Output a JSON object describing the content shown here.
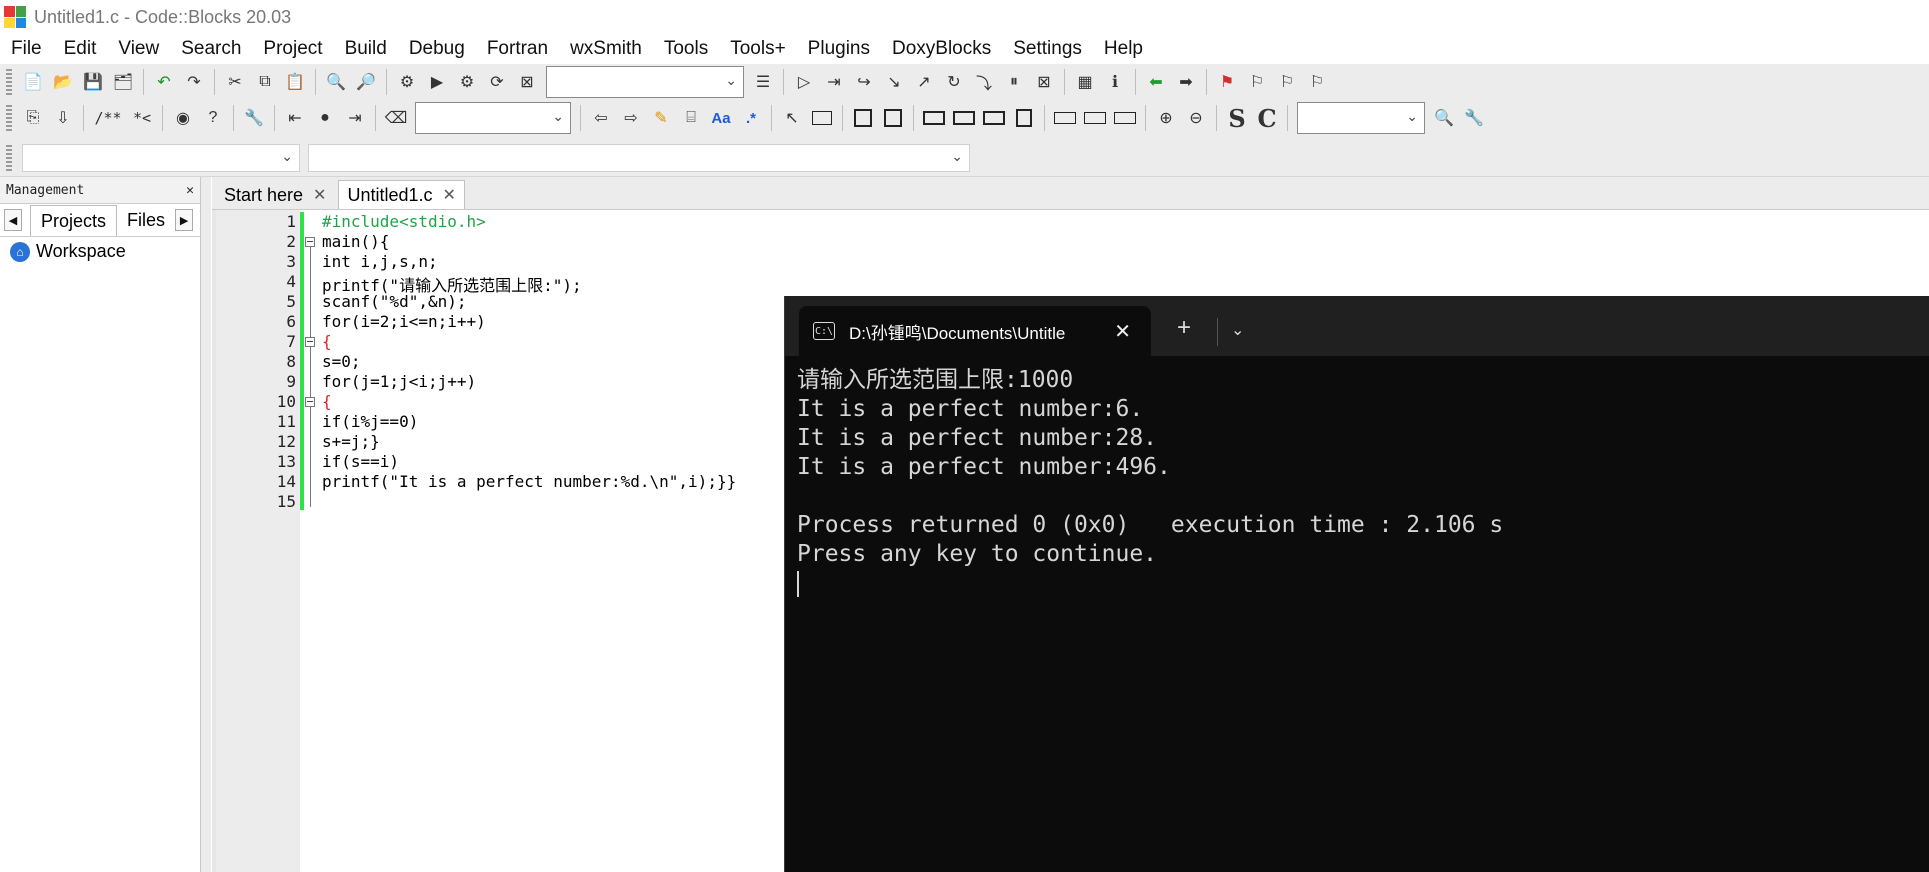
{
  "window": {
    "title": "Untitled1.c - Code::Blocks 20.03"
  },
  "menu": [
    "File",
    "Edit",
    "View",
    "Search",
    "Project",
    "Build",
    "Debug",
    "Fortran",
    "wxSmith",
    "Tools",
    "Tools+",
    "Plugins",
    "DoxyBlocks",
    "Settings",
    "Help"
  ],
  "toolbar": {
    "doxy_comment": "/**",
    "doxy_inline": "*<",
    "regex_label": "Aa",
    "regex_dot": ".*",
    "bold_s": "S",
    "bold_c": "C"
  },
  "management": {
    "title": "Management",
    "tabs": [
      "Projects",
      "Files"
    ],
    "workspace": "Workspace"
  },
  "editor": {
    "tabs": [
      "Start here",
      "Untitled1.c"
    ],
    "active_tab": "Untitled1.c",
    "line_numbers": [
      "1",
      "2",
      "3",
      "4",
      "5",
      "6",
      "7",
      "8",
      "9",
      "10",
      "11",
      "12",
      "13",
      "14",
      "15"
    ],
    "lines": [
      "#include<stdio.h>",
      "main(){",
      "int i,j,s,n;",
      "printf(\"请输入所选范围上限:\");",
      "scanf(\"%d\",&n);",
      "for(i=2;i<=n;i++)",
      "{",
      "s=0;",
      "for(j=1;j<i;j++)",
      "{",
      "if(i%j==0)",
      "s+=j;}",
      "if(s==i)",
      "printf(\"It is a perfect number:%d.\\n\",i);}}",
      ""
    ]
  },
  "terminal": {
    "tab_title": "D:\\孙锺鸣\\Documents\\Untitle",
    "output": [
      "请输入所选范围上限:1000",
      "It is a perfect number:6.",
      "It is a perfect number:28.",
      "It is a perfect number:496.",
      "",
      "Process returned 0 (0x0)   execution time : 2.106 s",
      "Press any key to continue."
    ]
  }
}
